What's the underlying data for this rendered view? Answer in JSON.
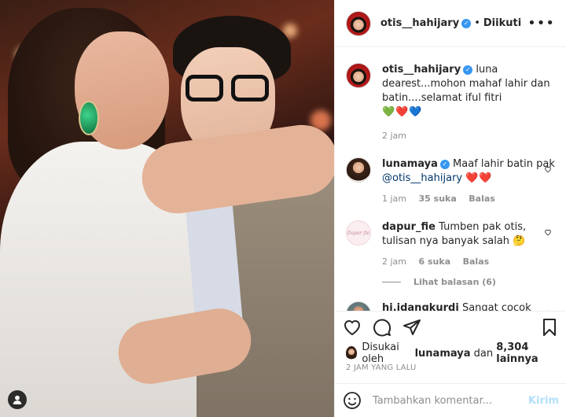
{
  "post": {
    "author": "otis__hahijary",
    "follow_status": "Diikuti",
    "more": "•••",
    "caption_text": "luna dearest...mohon mahaf lahir dan batin....selamat iful fitri",
    "caption_hearts": "💚❤️💙",
    "caption_time": "2 jam"
  },
  "comments": [
    {
      "username": "lunamaya",
      "text_before": "Maaf lahir batin pak",
      "mention": "@otis__hahijary",
      "emoji": "❤️❤️",
      "time": "1 jam",
      "likes": "35 suka",
      "reply": "Balas"
    },
    {
      "username": "dapur_fie",
      "avatar_text": "Dapur fie",
      "text": "Tumben pak otis, tulisan nya banyak salah",
      "emoji": "🤔",
      "time": "2 jam",
      "likes": "6 suka",
      "reply": "Balas",
      "view_replies": "Lihat balasan (6)"
    },
    {
      "username": "hj.idangkurdi",
      "text": "Sangat cocok luna sama pa otis semoga berjodoh",
      "emoji": "😍"
    }
  ],
  "likes": {
    "prefix": "Disukai oleh",
    "user": "lunamaya",
    "middle": "dan",
    "count": "8,304 lainnya"
  },
  "timestamp": "2 JAM YANG LALU",
  "add_comment": {
    "placeholder": "Tambahkan komentar...",
    "post_label": "Kirim"
  },
  "colors": {
    "verified": "#3897f0",
    "muted": "#8e8e8e",
    "post_disabled": "#b2dffc"
  }
}
